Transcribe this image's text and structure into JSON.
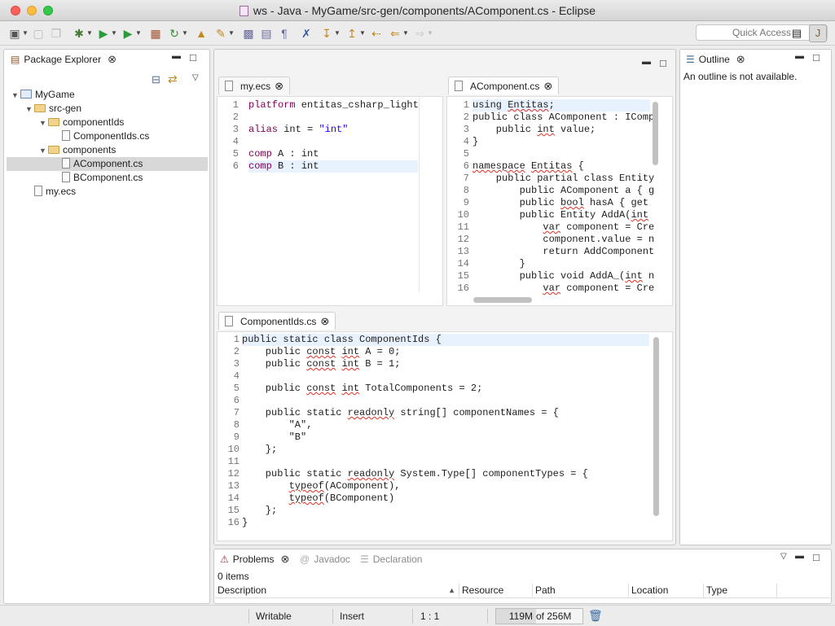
{
  "window": {
    "title": "ws - Java - MyGame/src-gen/components/AComponent.cs - Eclipse"
  },
  "toolbar": {
    "quick_access_placeholder": "Quick Access",
    "icons": [
      "new-wizard-icon",
      "save-icon",
      "save-all-icon",
      "debug-icon",
      "run-icon",
      "external-tools-icon",
      "new-package-icon",
      "refresh-icon",
      "open-type-icon",
      "search-icon",
      "toggle-mark-occurrences-icon",
      "show-whitespace-icon",
      "pilcrow-icon",
      "breakpoint-icon",
      "next-annotation-icon",
      "previous-annotation-icon",
      "last-edit-icon",
      "back-icon",
      "forward-icon"
    ]
  },
  "package_explorer": {
    "title": "Package Explorer",
    "items": [
      {
        "label": "MyGame",
        "type": "project",
        "depth": 0,
        "expanded": true
      },
      {
        "label": "src-gen",
        "type": "folder",
        "depth": 1,
        "expanded": true
      },
      {
        "label": "componentIds",
        "type": "folder",
        "depth": 2,
        "expanded": true
      },
      {
        "label": "ComponentIds.cs",
        "type": "file",
        "depth": 3
      },
      {
        "label": "components",
        "type": "folder",
        "depth": 2,
        "expanded": true
      },
      {
        "label": "AComponent.cs",
        "type": "file",
        "depth": 3,
        "selected": true
      },
      {
        "label": "BComponent.cs",
        "type": "file",
        "depth": 3
      },
      {
        "label": "my.ecs",
        "type": "file",
        "depth": 1
      }
    ]
  },
  "editors": {
    "my_ecs": {
      "tab": "my.ecs",
      "lines": [
        [
          {
            "t": "platform",
            "k": "kw"
          },
          {
            "t": " entitas_csharp_light"
          }
        ],
        [],
        [
          {
            "t": "alias",
            "k": "kw"
          },
          {
            "t": " int = "
          },
          {
            "t": "\"int\"",
            "k": "str"
          }
        ],
        [],
        [
          {
            "t": "comp",
            "k": "kw"
          },
          {
            "t": " A : int"
          }
        ],
        [
          {
            "t": "comp",
            "k": "kw"
          },
          {
            "t": " B : int"
          }
        ]
      ],
      "highlight_line": 6
    },
    "acomponent": {
      "tab": "AComponent.cs",
      "lines": [
        [
          {
            "t": "using "
          },
          {
            "t": "Entitas",
            "k": "sq"
          },
          {
            "t": ";"
          }
        ],
        [
          {
            "t": "public class AComponent : IComp"
          }
        ],
        [
          {
            "t": "    public "
          },
          {
            "t": "int",
            "k": "sq"
          },
          {
            "t": " value;"
          }
        ],
        [
          {
            "t": "}"
          }
        ],
        [],
        [
          {
            "t": "namespace",
            "k": "sq"
          },
          {
            "t": " "
          },
          {
            "t": "Entitas",
            "k": "sq"
          },
          {
            "t": " {"
          }
        ],
        [
          {
            "t": "    public partial class Entity"
          }
        ],
        [
          {
            "t": "        public AComponent a { g"
          }
        ],
        [
          {
            "t": "        public "
          },
          {
            "t": "bool",
            "k": "sq"
          },
          {
            "t": " hasA { get"
          }
        ],
        [
          {
            "t": "        public Entity AddA("
          },
          {
            "t": "int",
            "k": "sq"
          }
        ],
        [
          {
            "t": "            "
          },
          {
            "t": "var",
            "k": "sq"
          },
          {
            "t": " component = Cre"
          }
        ],
        [
          {
            "t": "            component.value = n"
          }
        ],
        [
          {
            "t": "            return AddComponent"
          }
        ],
        [
          {
            "t": "        }"
          }
        ],
        [
          {
            "t": "        public void AddA_("
          },
          {
            "t": "int",
            "k": "sq"
          },
          {
            "t": " n"
          }
        ],
        [
          {
            "t": "            "
          },
          {
            "t": "var",
            "k": "sq"
          },
          {
            "t": " component = Cre"
          }
        ]
      ],
      "highlight_line": 1
    },
    "componentids": {
      "tab": "ComponentIds.cs",
      "lines": [
        [
          {
            "t": "public static class ComponentIds {"
          }
        ],
        [
          {
            "t": "    public "
          },
          {
            "t": "const",
            "k": "sq"
          },
          {
            "t": " "
          },
          {
            "t": "int",
            "k": "sq"
          },
          {
            "t": " A = 0;"
          }
        ],
        [
          {
            "t": "    public "
          },
          {
            "t": "const",
            "k": "sq"
          },
          {
            "t": " "
          },
          {
            "t": "int",
            "k": "sq"
          },
          {
            "t": " B = 1;"
          }
        ],
        [],
        [
          {
            "t": "    public "
          },
          {
            "t": "const",
            "k": "sq"
          },
          {
            "t": " "
          },
          {
            "t": "int",
            "k": "sq"
          },
          {
            "t": " TotalComponents = 2;"
          }
        ],
        [],
        [
          {
            "t": "    public static "
          },
          {
            "t": "readonly",
            "k": "sq"
          },
          {
            "t": " string[] componentNames = {"
          }
        ],
        [
          {
            "t": "        \"A\","
          }
        ],
        [
          {
            "t": "        \"B\""
          }
        ],
        [
          {
            "t": "    };"
          }
        ],
        [],
        [
          {
            "t": "    public static "
          },
          {
            "t": "readonly",
            "k": "sq"
          },
          {
            "t": " System.Type[] componentTypes = {"
          }
        ],
        [
          {
            "t": "        "
          },
          {
            "t": "typeof",
            "k": "sq"
          },
          {
            "t": "(AComponent),"
          }
        ],
        [
          {
            "t": "        "
          },
          {
            "t": "typeof",
            "k": "sq"
          },
          {
            "t": "(BComponent)"
          }
        ],
        [
          {
            "t": "    };"
          }
        ],
        [
          {
            "t": "}"
          }
        ]
      ],
      "highlight_line": 1
    }
  },
  "outline": {
    "title": "Outline",
    "message": "An outline is not available."
  },
  "bottom_panel": {
    "tabs": [
      {
        "label": "Problems",
        "active": true
      },
      {
        "label": "Javadoc",
        "active": false
      },
      {
        "label": "Declaration",
        "active": false
      }
    ],
    "summary": "0 items",
    "columns": [
      "Description",
      "Resource",
      "Path",
      "Location",
      "Type"
    ]
  },
  "status_bar": {
    "writable": "Writable",
    "insert_mode": "Insert",
    "position": "1 : 1",
    "memory_used": "119M",
    "memory_total": "of 256M",
    "memory_fraction": 0.465
  }
}
